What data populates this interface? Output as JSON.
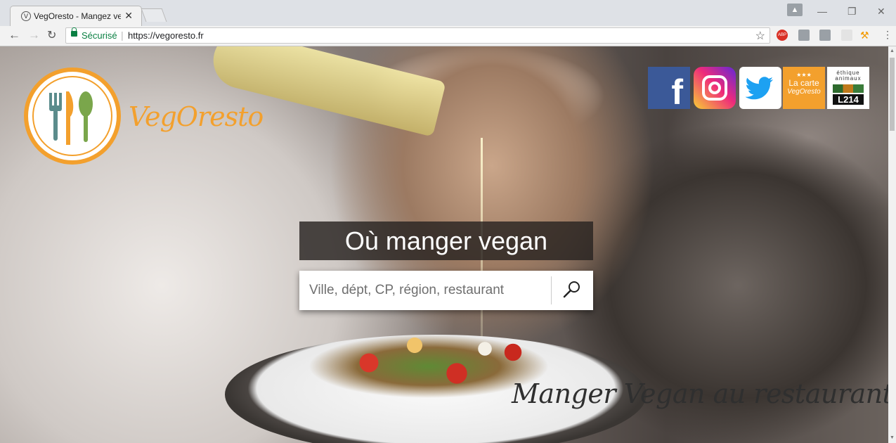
{
  "browser": {
    "tab_title": "VegOresto - Mangez veg",
    "tab_favicon": "V",
    "tab_close": "✕",
    "secure_label": "Sécurisé",
    "url": "https://vegoresto.fr",
    "window_controls": {
      "minimize": "—",
      "restore": "❐",
      "close": "✕"
    }
  },
  "logo": {
    "text": "VegOresto"
  },
  "social": {
    "facebook": "f",
    "carte": {
      "stars": "★★★",
      "line1": "La carte",
      "line2": "VegOresto"
    },
    "l214": {
      "top": "éthique animaux",
      "bottom": "L214"
    }
  },
  "hero": {
    "title": "Où manger vegan",
    "search_placeholder": "Ville, dépt, CP, région, restaurant",
    "tagline": "Manger Vegan au restaurant"
  },
  "colors": {
    "brand_orange": "#f3a02d",
    "facebook": "#3b5998",
    "twitter": "#1da1f2"
  },
  "icons": [
    "browser-favicon-icon",
    "back-icon",
    "forward-icon",
    "reload-icon",
    "lock-icon",
    "star-icon",
    "adblock-icon",
    "extension-icon",
    "wrench-icon",
    "menu-icon",
    "search-icon",
    "facebook-icon",
    "instagram-icon",
    "twitter-icon"
  ]
}
